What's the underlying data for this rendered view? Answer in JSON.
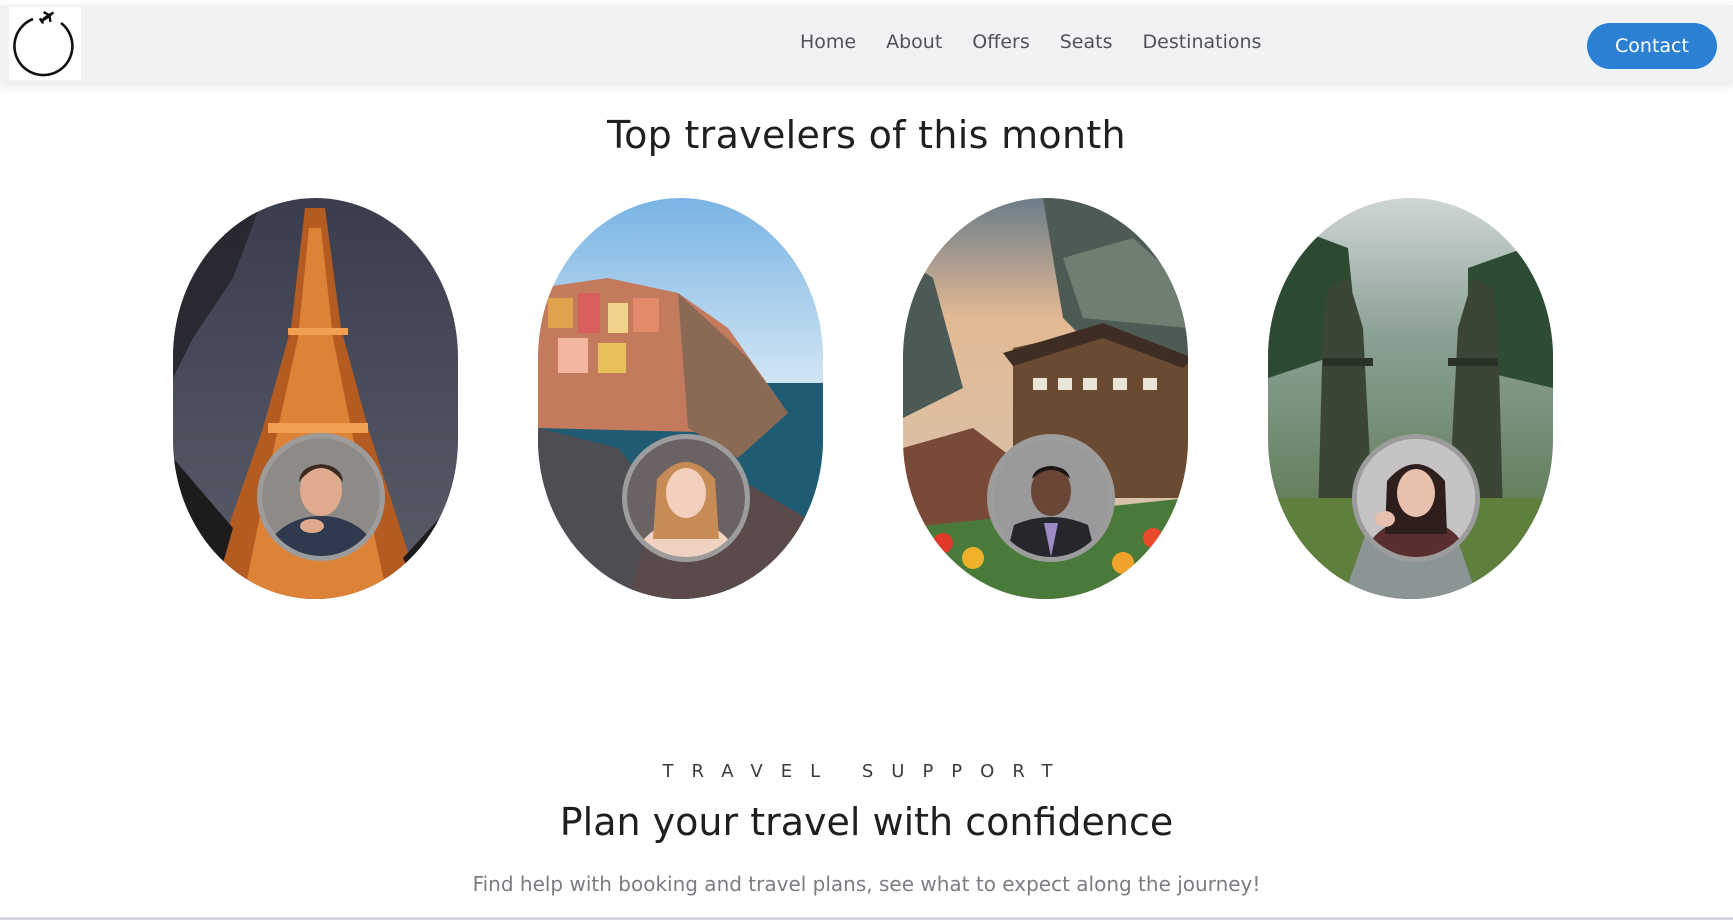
{
  "nav": {
    "logo_icon": "airplane-orbit-logo-icon",
    "links": [
      "Home",
      "About",
      "Offers",
      "Seats",
      "Destinations"
    ],
    "contact_label": "Contact",
    "accent_color": "#2c80d3"
  },
  "travelers": {
    "heading": "Top travelers of this month",
    "cards": [
      {
        "destination_image": "eiffel-tower-night-image",
        "avatar_image": "traveler-avatar-1"
      },
      {
        "destination_image": "cinque-terre-coast-image",
        "avatar_image": "traveler-avatar-2"
      },
      {
        "destination_image": "alpine-village-image",
        "avatar_image": "traveler-avatar-3"
      },
      {
        "destination_image": "bali-temple-gate-image",
        "avatar_image": "traveler-avatar-4"
      }
    ]
  },
  "support": {
    "eyebrow": "TRAVEL SUPPORT",
    "heading": "Plan your travel with confidence",
    "subtext": "Find help with booking and travel plans, see what to expect along the journey!"
  }
}
